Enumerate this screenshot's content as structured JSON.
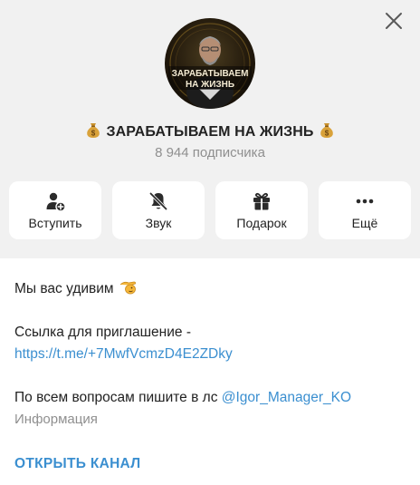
{
  "channel": {
    "avatar_text_line1": "ЗАРАБАТЫВАЕМ",
    "avatar_text_line2": "НА ЖИЗНЬ",
    "title": "ЗАРАБАТЫВАЕМ НА ЖИЗНЬ",
    "subscribers": "8 944 подписчика"
  },
  "actions": [
    {
      "label": "Вступить",
      "icon": "add-user-icon"
    },
    {
      "label": "Звук",
      "icon": "bell-muted-icon"
    },
    {
      "label": "Подарок",
      "icon": "gift-icon"
    },
    {
      "label": "Ещё",
      "icon": "more-dots-icon"
    }
  ],
  "description": {
    "line1": "Мы вас удивим",
    "invite_label": "Ссылка для приглашение -",
    "invite_link": "https://t.me/+7MwfVcmzD4E2ZDky",
    "contact_text": "По всем вопросам пишите в лс ",
    "contact_handle": "@Igor_Manager_KO",
    "info_label": "Информация"
  },
  "open_channel_label": "ОТКРЫТЬ КАНАЛ",
  "colors": {
    "accent": "#3b8fd0",
    "header_bg": "#f1f1f1",
    "muted": "#8f8f8f",
    "avatar_text": "#f0e6c8"
  }
}
